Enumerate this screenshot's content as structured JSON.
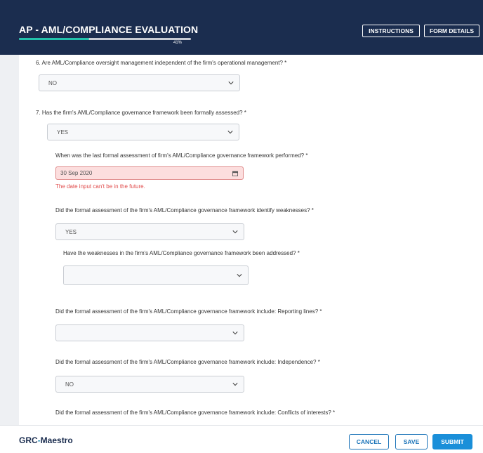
{
  "header": {
    "title": "AP - AML/COMPLIANCE EVALUATION",
    "progress_label": "41%",
    "progress_value": 0.41,
    "instructions_label": "INSTRUCTIONS",
    "form_details_label": "FORM DETAILS"
  },
  "form": {
    "q6": {
      "text": "6.   Are AML/Compliance oversight management independent of the firm's operational management? *",
      "value": "NO"
    },
    "q7": {
      "text": "7.   Has the firm's AML/Compliance governance framework been formally assessed? *",
      "value": "YES"
    },
    "q7a": {
      "text": "When was the last formal assessment of firm's AML/Compliance governance framework performed? *",
      "value": "30 Sep 2020",
      "error": "The date input can't be in the future."
    },
    "q7b": {
      "text": "Did the formal assessment of the firm's AML/Compliance governance framework identify weaknesses? *",
      "value": "YES"
    },
    "q7b1": {
      "text": "Have the weaknesses in the firm's AML/Compliance governance framework been addressed? *",
      "value": ""
    },
    "q7c": {
      "text": "Did the formal assessment of the firm's AML/Compliance governance framework include: Reporting lines? *",
      "value": ""
    },
    "q7d": {
      "text": "Did the formal assessment of the firm's AML/Compliance governance framework include: Independence? *",
      "value": "NO"
    },
    "q7e": {
      "text": "Did the formal assessment of the firm's AML/Compliance governance framework include: Conflicts of interests? *"
    }
  },
  "footer": {
    "logo_main": "GRC",
    "logo_sep": "-",
    "logo_accent": "Maestro",
    "cancel_label": "CANCEL",
    "save_label": "SAVE",
    "submit_label": "SUBMIT"
  },
  "colors": {
    "header_bg": "#1b2d4f",
    "progress": "#22c2ac",
    "error": "#e04a4a",
    "primary": "#1a8fd9"
  }
}
